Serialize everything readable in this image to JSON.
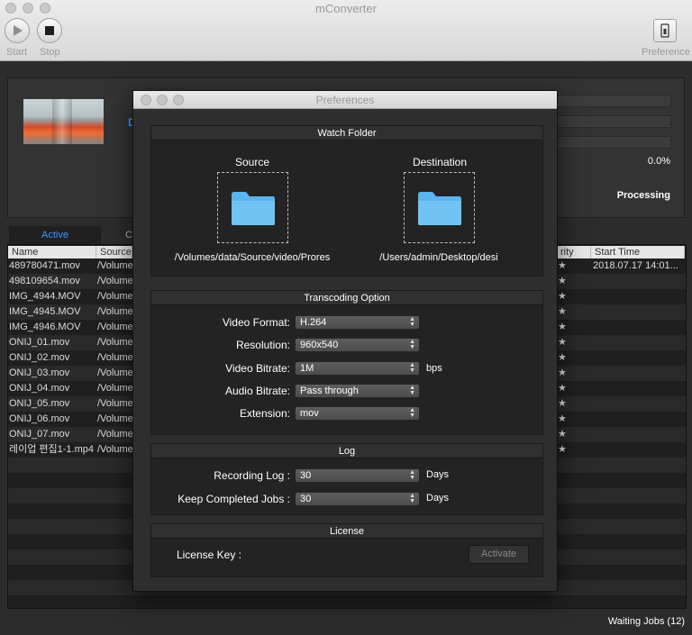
{
  "app": {
    "title": "mConverter",
    "toolbar": {
      "start_label": "Start",
      "stop_label": "Stop",
      "preference_label": "Preference"
    }
  },
  "progress": {
    "percent_text": "0.0%",
    "status_text": "Processing",
    "partial_label": "D"
  },
  "tabs": {
    "active_label": "Active",
    "other_label": "C"
  },
  "table": {
    "columns": {
      "name": "Name",
      "source": "Source",
      "priority": "rity",
      "start_time": "Start Time"
    },
    "rows": [
      {
        "name": "489780471.mov",
        "source": "/Volume",
        "priority": "★",
        "start_time": "2018.07.17 14:01..."
      },
      {
        "name": "498109654.mov",
        "source": "/Volume",
        "priority": "★",
        "start_time": ""
      },
      {
        "name": "IMG_4944.MOV",
        "source": "/Volume",
        "priority": "★",
        "start_time": ""
      },
      {
        "name": "IMG_4945.MOV",
        "source": "/Volume",
        "priority": "★",
        "start_time": ""
      },
      {
        "name": "IMG_4946.MOV",
        "source": "/Volume",
        "priority": "★",
        "start_time": ""
      },
      {
        "name": "ONIJ_01.mov",
        "source": "/Volume",
        "priority": "★",
        "start_time": ""
      },
      {
        "name": "ONIJ_02.mov",
        "source": "/Volume",
        "priority": "★",
        "start_time": ""
      },
      {
        "name": "ONIJ_03.mov",
        "source": "/Volume",
        "priority": "★",
        "start_time": ""
      },
      {
        "name": "ONIJ_04.mov",
        "source": "/Volume",
        "priority": "★",
        "start_time": ""
      },
      {
        "name": "ONIJ_05.mov",
        "source": "/Volume",
        "priority": "★",
        "start_time": ""
      },
      {
        "name": "ONIJ_06.mov",
        "source": "/Volume",
        "priority": "★",
        "start_time": ""
      },
      {
        "name": "ONIJ_07.mov",
        "source": "/Volume",
        "priority": "★",
        "start_time": ""
      },
      {
        "name": "레이업 편집1-1.mp4",
        "source": "/Volume",
        "priority": "★",
        "start_time": ""
      }
    ]
  },
  "status_bar": {
    "waiting": "Waiting Jobs (12)"
  },
  "preferences": {
    "title": "Preferences",
    "watch_folder": {
      "header": "Watch Folder",
      "source_label": "Source",
      "source_path": "/Volumes/data/Source/video/Prores",
      "destination_label": "Destination",
      "destination_path": "/Users/admin/Desktop/desi"
    },
    "transcoding": {
      "header": "Transcoding Option",
      "video_format_label": "Video Format:",
      "video_format": "H.264",
      "resolution_label": "Resolution:",
      "resolution": "960x540",
      "video_bitrate_label": "Video Bitrate:",
      "video_bitrate": "1M",
      "bitrate_unit": "bps",
      "audio_bitrate_label": "Audio Bitrate:",
      "audio_bitrate": "Pass through",
      "extension_label": "Extension:",
      "extension": "mov"
    },
    "log": {
      "header": "Log",
      "recording_log_label": "Recording Log :",
      "recording_log": "30",
      "keep_jobs_label": "Keep Completed Jobs :",
      "keep_jobs": "30",
      "days_unit": "Days"
    },
    "license": {
      "header": "License",
      "key_label": "License Key :",
      "activate_label": "Activate"
    }
  },
  "colors": {
    "accent": "#3b99fc",
    "folder": "#5ab4ee"
  }
}
